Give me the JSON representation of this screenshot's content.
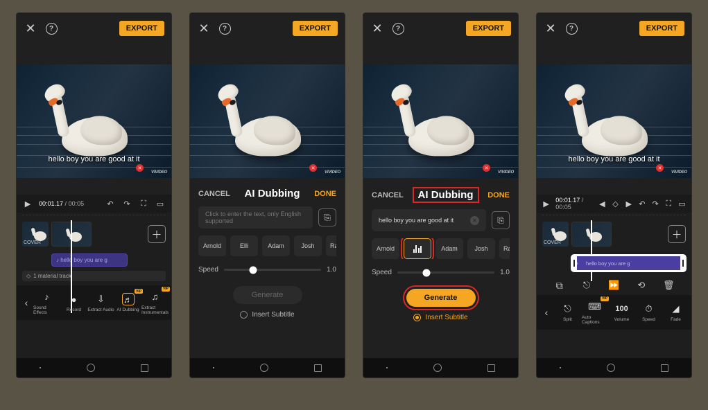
{
  "header": {
    "export_label": "EXPORT"
  },
  "subtitle_overlay": "hello boy you are good at it",
  "watermark": "VIVIDEO",
  "playbar": {
    "current": "00:01.17",
    "duration": "00:05"
  },
  "timeline": {
    "cover_label": "COVER",
    "audio_pill_prefix": "hello boy you are g",
    "material_track": "1 material track"
  },
  "toolbar_main": {
    "back": "‹",
    "items": [
      {
        "label": "Sound Effects",
        "icon": "♪"
      },
      {
        "label": "Record",
        "icon": "●"
      },
      {
        "label": "Extract Audio",
        "icon": "⇩"
      },
      {
        "label": "AI Dubbing",
        "icon": "♬",
        "vip": "VIP",
        "hi": true
      },
      {
        "label": "Extract Instrumentals",
        "icon": "♫",
        "vip": "VIP"
      }
    ]
  },
  "dubbing": {
    "cancel": "CANCEL",
    "title": "AI Dubbing",
    "done": "DONE",
    "placeholder": "Click to enter the text, only English supported",
    "text_value": "hello boy you are good at it",
    "voices": [
      "Arnold",
      "Elli",
      "Adam",
      "Josh",
      "Rachel"
    ],
    "speed_label": "Speed",
    "speed_value": "1.0",
    "generate": "Generate",
    "insert_subtitle": "Insert Subtitle"
  },
  "toolbar_clip": {
    "items": [
      {
        "label": "Split",
        "icon": "⎋"
      },
      {
        "label": "Auto Captions",
        "icon": "⌨",
        "vip": "VIP"
      },
      {
        "label": "Volume",
        "icon": "100"
      },
      {
        "label": "Speed",
        "icon": "⏱"
      },
      {
        "label": "Fade",
        "icon": "◢"
      }
    ]
  },
  "clip_label": "hello boy you are g"
}
